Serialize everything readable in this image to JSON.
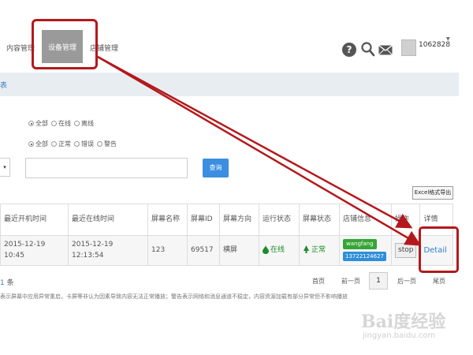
{
  "nav": {
    "items": [
      "内容管理",
      "设备管理",
      "店铺管理"
    ],
    "active_index": 1,
    "username": "1062828"
  },
  "breadcrumb": "表",
  "filters": {
    "status_row": [
      {
        "label": "全部",
        "checked": true
      },
      {
        "label": "在线",
        "checked": false
      },
      {
        "label": "离线",
        "checked": false
      }
    ],
    "state_row": [
      {
        "label": "全部",
        "checked": true
      },
      {
        "label": "正常",
        "checked": false
      },
      {
        "label": "错误",
        "checked": false
      },
      {
        "label": "警告",
        "checked": false
      }
    ],
    "query_input_value": "",
    "query_button": "查询",
    "select_stub": "▾"
  },
  "export_button": "Excel格式导出",
  "table": {
    "headers": [
      "最近开机时间",
      "最近在线时间",
      "屏幕名称",
      "屏幕ID",
      "屏幕方向",
      "运行状态",
      "屏幕状态",
      "店铺信息",
      "操作",
      "详情"
    ],
    "row": {
      "boot_time": "2015-12-19 10:45",
      "online_time": "2015-12-19 12:13:54",
      "screen_name": "123",
      "screen_id": "69517",
      "orientation": "横屏",
      "run_status": "在线",
      "screen_status": "正常",
      "shop_name": "wangfang",
      "shop_phone": "13722124627",
      "action": "stop",
      "detail": "Detail"
    }
  },
  "pagination": {
    "total": "1",
    "total_suffix": "条",
    "first": "首页",
    "prev": "前一页",
    "current": "1",
    "next": "后一页",
    "last": "尾页"
  },
  "footnote": "表示屏幕中应用异常重启，卡屏等非认为因素导致内容无法正常播放；警告表示网络和消息通道不稳定，内容资源加载有部分异常但不影响播放",
  "watermark": "Bai度经验",
  "watermark_url": "jingyan.baidu.com",
  "colors": {
    "highlight": "#b3191c",
    "active_nav": "#9a9a9a",
    "link": "#2e7fd0"
  }
}
